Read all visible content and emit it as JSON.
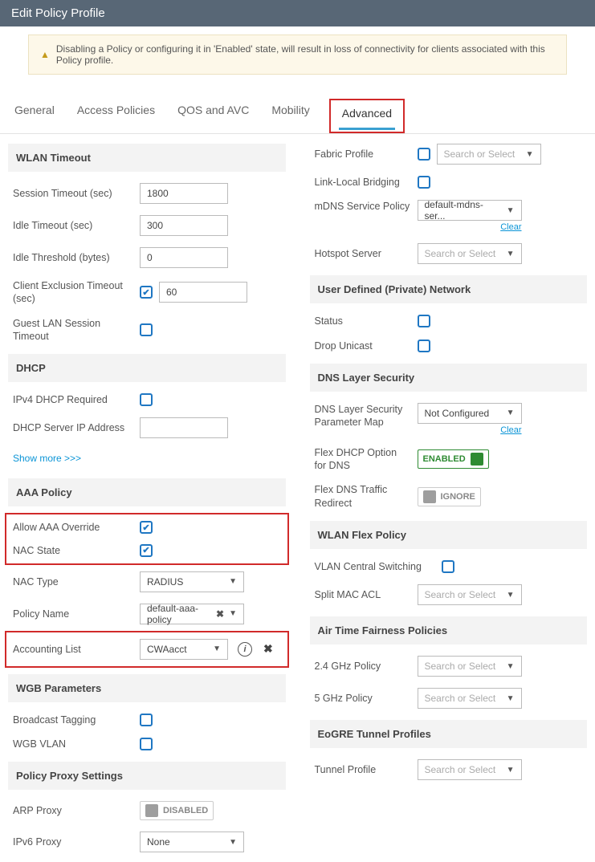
{
  "header": {
    "title": "Edit Policy Profile"
  },
  "alert": {
    "text": "Disabling a Policy or configuring it in 'Enabled' state, will result in loss of connectivity for clients associated with this Policy profile."
  },
  "tabs": {
    "general": "General",
    "access": "Access Policies",
    "qos": "QOS and AVC",
    "mobility": "Mobility",
    "advanced": "Advanced"
  },
  "left": {
    "wlan_timeout": "WLAN Timeout",
    "session_timeout": {
      "label": "Session Timeout (sec)",
      "value": "1800"
    },
    "idle_timeout": {
      "label": "Idle Timeout (sec)",
      "value": "300"
    },
    "idle_threshold": {
      "label": "Idle Threshold (bytes)",
      "value": "0"
    },
    "client_exclusion": {
      "label": "Client Exclusion Timeout (sec)",
      "value": "60"
    },
    "guest_lan": {
      "label": "Guest LAN Session Timeout"
    },
    "dhcp": "DHCP",
    "ipv4_required": {
      "label": "IPv4 DHCP Required"
    },
    "dhcp_server": {
      "label": "DHCP Server IP Address",
      "value": ""
    },
    "show_more": "Show more >>>",
    "aaa_policy": "AAA Policy",
    "allow_aaa": {
      "label": "Allow AAA Override"
    },
    "nac_state": {
      "label": "NAC State"
    },
    "nac_type": {
      "label": "NAC Type",
      "value": "RADIUS"
    },
    "policy_name": {
      "label": "Policy Name",
      "value": "default-aaa-policy"
    },
    "accounting_list": {
      "label": "Accounting List",
      "value": "CWAacct"
    },
    "wgb_params": "WGB Parameters",
    "broadcast_tagging": {
      "label": "Broadcast Tagging"
    },
    "wgb_vlan": {
      "label": "WGB VLAN"
    },
    "proxy_settings": "Policy Proxy Settings",
    "arp_proxy": {
      "label": "ARP Proxy",
      "value": "DISABLED"
    },
    "ipv6_proxy": {
      "label": "IPv6 Proxy",
      "value": "None"
    }
  },
  "right": {
    "fabric_profile": {
      "label": "Fabric Profile",
      "placeholder": "Search or Select"
    },
    "link_local": {
      "label": "Link-Local Bridging"
    },
    "mdns": {
      "label": "mDNS Service Policy",
      "value": "default-mdns-ser...",
      "clear": "Clear"
    },
    "hotspot": {
      "label": "Hotspot Server",
      "placeholder": "Search or Select"
    },
    "udn": "User Defined (Private) Network",
    "status": {
      "label": "Status"
    },
    "drop_unicast": {
      "label": "Drop Unicast"
    },
    "dns_sec": "DNS Layer Security",
    "dns_param": {
      "label": "DNS Layer Security Parameter Map",
      "value": "Not Configured",
      "clear": "Clear"
    },
    "flex_dhcp": {
      "label": "Flex DHCP Option for DNS",
      "value": "ENABLED"
    },
    "flex_dns": {
      "label": "Flex DNS Traffic Redirect",
      "value": "IGNORE"
    },
    "wlan_flex": "WLAN Flex Policy",
    "vlan_central": {
      "label": "VLAN Central Switching"
    },
    "split_mac": {
      "label": "Split MAC ACL",
      "placeholder": "Search or Select"
    },
    "atf": "Air Time Fairness Policies",
    "p24": {
      "label": "2.4 GHz Policy",
      "placeholder": "Search or Select"
    },
    "p5": {
      "label": "5 GHz Policy",
      "placeholder": "Search or Select"
    },
    "eogre": "EoGRE Tunnel Profiles",
    "tunnel": {
      "label": "Tunnel Profile",
      "placeholder": "Search or Select"
    }
  }
}
